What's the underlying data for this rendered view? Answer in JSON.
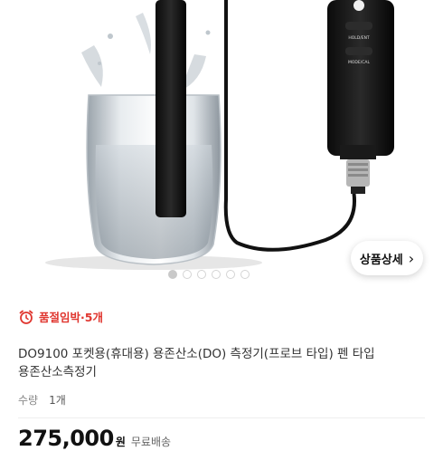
{
  "gallery": {
    "device_buttons": [
      "HOLD/ENT",
      "MODE/CAL"
    ],
    "dot_count": 6,
    "active_dot": 0
  },
  "detail_button": {
    "label": "상품상세",
    "icon": "chevron-right-icon"
  },
  "stock_badge": {
    "icon": "alarm-clock-icon",
    "text": "품절임박·5개",
    "color": "#e0362f"
  },
  "product": {
    "title_line1": "DO9100 포켓용(휴대용) 용존산소(DO) 측정기(프로브 타입) 펜 타입",
    "title_line2": "용존산소측정기"
  },
  "quantity": {
    "label": "수량",
    "value": "1개"
  },
  "price": {
    "amount": "275,000",
    "unit": "원",
    "shipping": "무료배송"
  }
}
